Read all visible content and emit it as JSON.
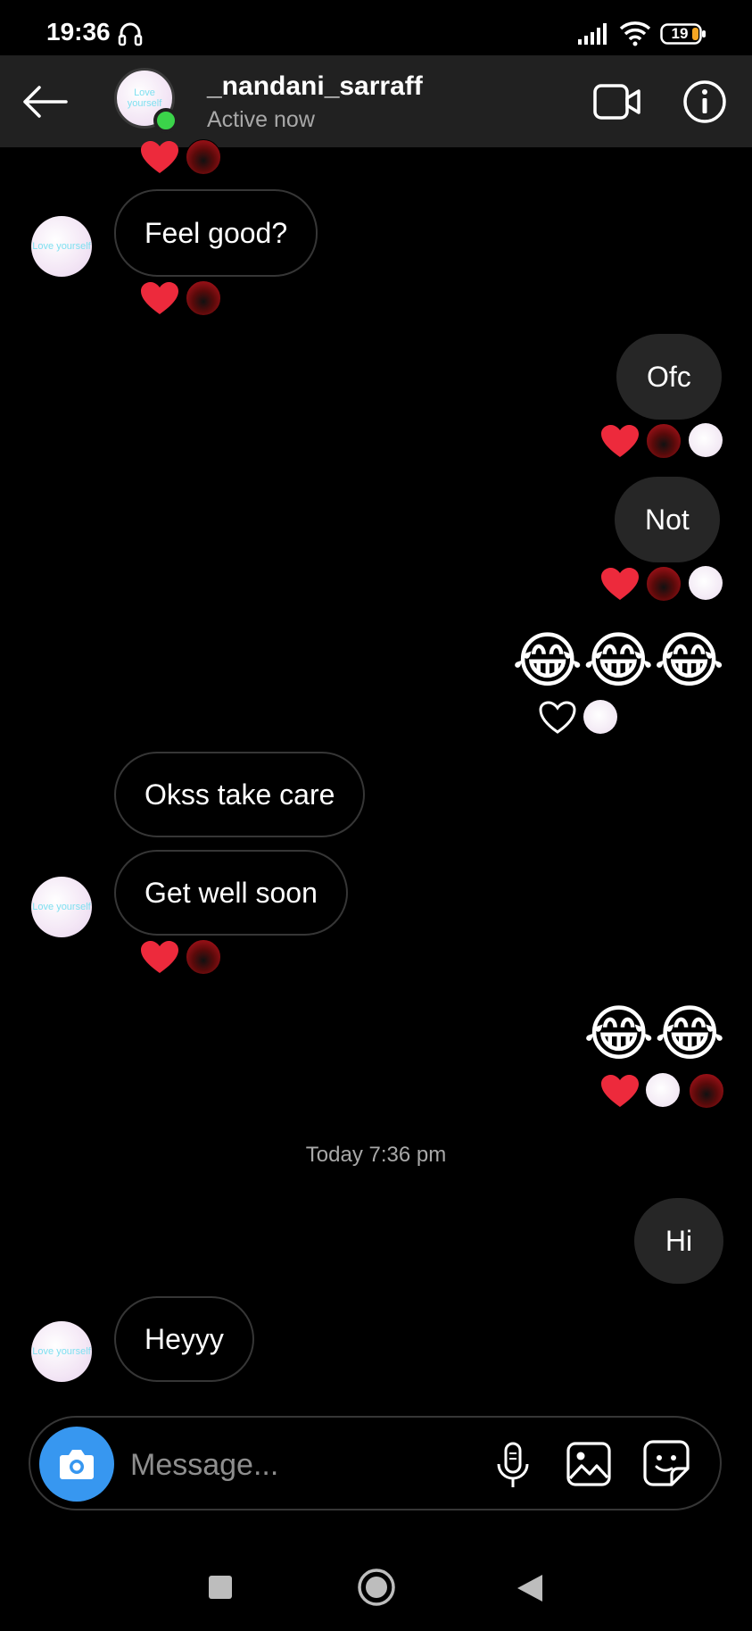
{
  "status_bar": {
    "time": "19:36",
    "battery": "19"
  },
  "header": {
    "username": "_nandani_sarraff",
    "status": "Active now",
    "avatar_text": "Love yourself"
  },
  "messages": {
    "m1": "Feel good?",
    "m2": "Ofc",
    "m3": "Not",
    "m4": "😂😂😂",
    "m5": "Okss take care",
    "m6": "Get well soon",
    "m7": "😂😂",
    "timestamp": "Today 7:36 pm",
    "m8": "Hi",
    "m9": "Heyyy"
  },
  "composer": {
    "placeholder": "Message..."
  },
  "colors": {
    "accent": "#3797f0",
    "heart": "#ed2a3c",
    "online": "#3bd34a",
    "bubble_out": "#262626"
  },
  "icons": [
    "back-arrow-icon",
    "video-call-icon",
    "info-icon",
    "camera-icon",
    "microphone-icon",
    "gallery-icon",
    "sticker-icon",
    "heart-icon"
  ]
}
